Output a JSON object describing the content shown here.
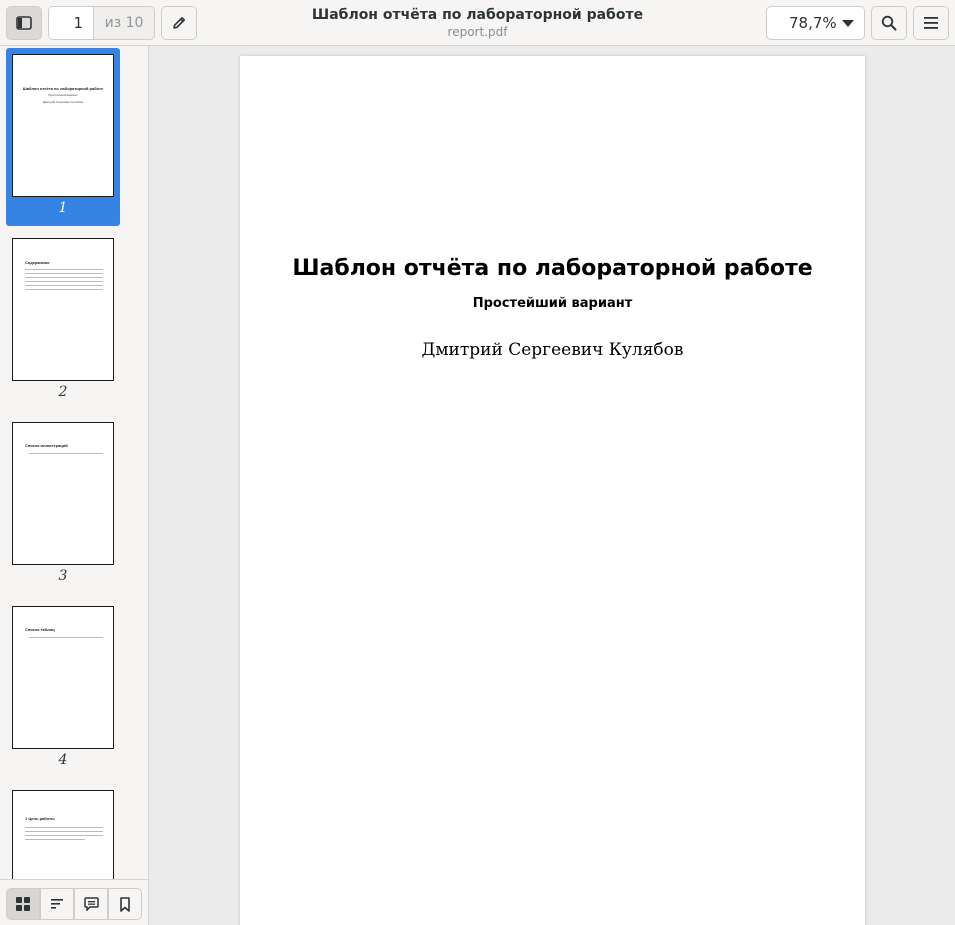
{
  "header": {
    "title": "Шаблон отчёта по лабораторной работе",
    "filename": "report.pdf",
    "page_current": "1",
    "page_total": "из 10",
    "zoom": "78,7%"
  },
  "sidebar": {
    "thumbnails": [
      {
        "number": "1",
        "heading": "Шаблон отчёта по лабораторной работе",
        "sub": "Простейший вариант",
        "author": "Дмитрий Сергеевич Кулябов"
      },
      {
        "number": "2",
        "heading": "Содержание"
      },
      {
        "number": "3",
        "heading": "Список иллюстраций"
      },
      {
        "number": "4",
        "heading": "Список таблиц"
      },
      {
        "number": "5",
        "heading": "1 Цель работы"
      }
    ]
  },
  "document": {
    "title": "Шаблон отчёта по лабораторной работе",
    "subtitle": "Простейший вариант",
    "author": "Дмитрий Сергеевич Кулябов"
  },
  "colors": {
    "accent": "#3584e4"
  }
}
